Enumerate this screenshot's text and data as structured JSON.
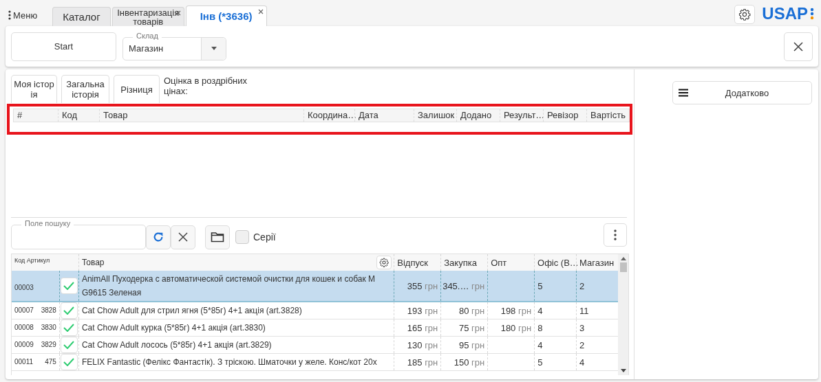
{
  "topbar": {
    "menu_label": "Меню",
    "logo": "USAP",
    "tabs": [
      {
        "label": "Каталог",
        "selected": false,
        "closable": false
      },
      {
        "label": "Інвентаризація товарів",
        "selected": false,
        "closable": true
      },
      {
        "label": "Інв (*3636)",
        "selected": true,
        "closable": true
      }
    ]
  },
  "toolbar": {
    "start_button": "Start",
    "warehouse": {
      "label": "Склад",
      "value": "Магазин"
    }
  },
  "history_tabs": [
    {
      "label": "Моя історія",
      "selected": false
    },
    {
      "label": "Загальна історія",
      "selected": false
    },
    {
      "label": "Різниця",
      "selected": false
    }
  ],
  "estimate_label": "Оцінка в роздрібних цінах:",
  "extra_button": "Додатково",
  "history_table": {
    "columns": [
      "#",
      "Код",
      "Товар",
      "Координа…",
      "Дата",
      "Залишок",
      "Додано",
      "Результ…",
      "Ревізор",
      "Вартість"
    ]
  },
  "search": {
    "label": "Поле пошуку",
    "series_label": "Серії",
    "series_checked": false
  },
  "goods_table": {
    "columns": [
      "Код Артикул",
      "Товар",
      "Відпуск",
      "Закупка",
      "Опт",
      "Офіс (В…",
      "Магазин"
    ],
    "rows": [
      {
        "code": "00003",
        "article": "",
        "checked": true,
        "selected": true,
        "name": "AnimAll Пуходерка с автоматической системой очистки для кошек и собак M G9615 Зеленая",
        "retail": "355",
        "retail_unit": "грн",
        "purchase": "345.…",
        "purchase_unit": "грн",
        "wholesale": "",
        "wholesale_unit": "",
        "office": "5",
        "shop": "2"
      },
      {
        "code": "00007",
        "article": "3828",
        "checked": true,
        "selected": false,
        "name": "Cat Chow Adult для стрил ягня (5*85г) 4+1 акція (art.3828)",
        "retail": "193",
        "retail_unit": "грн",
        "purchase": "80",
        "purchase_unit": "грн",
        "wholesale": "198",
        "wholesale_unit": "грн",
        "office": "4",
        "shop": "11"
      },
      {
        "code": "00008",
        "article": "3830",
        "checked": true,
        "selected": false,
        "name": "Cat Chow Adult курка (5*85г) 4+1 акція (art.3830)",
        "retail": "165",
        "retail_unit": "грн",
        "purchase": "75",
        "purchase_unit": "грн",
        "wholesale": "180",
        "wholesale_unit": "грн",
        "office": "8",
        "shop": "3"
      },
      {
        "code": "00009",
        "article": "3829",
        "checked": true,
        "selected": false,
        "name": "Cat Chow Adult лосось (5*85г) 4+1 акція (art.3829)",
        "retail": "130",
        "retail_unit": "грн",
        "purchase": "95",
        "purchase_unit": "грн",
        "wholesale": "",
        "wholesale_unit": "",
        "office": "4",
        "shop": "2"
      },
      {
        "code": "00011",
        "article": "475",
        "checked": true,
        "selected": false,
        "name": "FELIX Fantastic (Фелікс Фантастік). З тріскою. Шматочки у желе. Конс/кот 20х",
        "retail": "185",
        "retail_unit": "грн",
        "purchase": "150",
        "purchase_unit": "грн",
        "wholesale": "",
        "wholesale_unit": "",
        "office": "5",
        "shop": "4"
      }
    ]
  }
}
